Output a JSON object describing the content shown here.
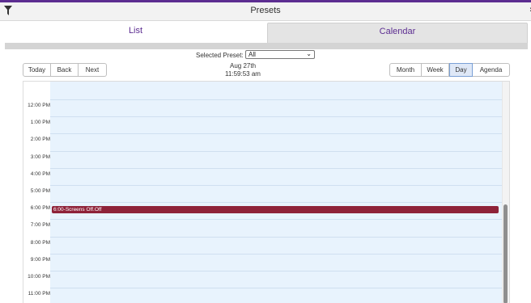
{
  "header": {
    "title": "Presets",
    "filter_icon": "filter-icon",
    "close_icon": "close-icon",
    "accent_color": "#5c2d91"
  },
  "tabs": [
    {
      "label": "List",
      "selected": true
    },
    {
      "label": "Calendar",
      "selected": false
    }
  ],
  "preset": {
    "label": "Selected Preset:",
    "value": "All"
  },
  "toolbar": {
    "today": "Today",
    "back": "Back",
    "next": "Next",
    "date": "Aug 27th",
    "time": "11:59:53 am",
    "views": [
      {
        "label": "Month",
        "active": false
      },
      {
        "label": "Week",
        "active": false
      },
      {
        "label": "Day",
        "active": true
      },
      {
        "label": "Agenda",
        "active": false
      }
    ]
  },
  "calendar": {
    "hours": [
      "12:00 PM",
      "1:00 PM",
      "2:00 PM",
      "3:00 PM",
      "4:00 PM",
      "5:00 PM",
      "6:00 PM",
      "7:00 PM",
      "8:00 PM",
      "9:00 PM",
      "10:00 PM",
      "11:00 PM"
    ],
    "events": [
      {
        "label": "6:00-Screens Off.Off",
        "color": "#8e2239"
      }
    ]
  }
}
